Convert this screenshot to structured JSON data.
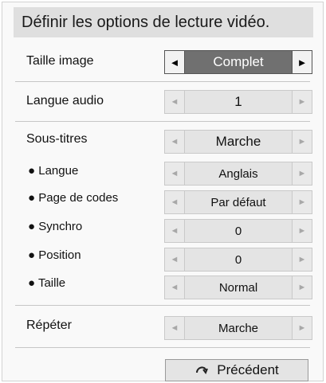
{
  "title": "Définir les options de lecture vidéo.",
  "rows": {
    "taille_image": {
      "label": "Taille image",
      "value": "Complet"
    },
    "langue_audio": {
      "label": "Langue audio",
      "value": "1"
    },
    "sous_titres": {
      "label": "Sous-titres",
      "value": "Marche"
    },
    "langue": {
      "label": "● Langue",
      "value": "Anglais"
    },
    "page_codes": {
      "label": "● Page de codes",
      "value": "Par défaut"
    },
    "synchro": {
      "label": "● Synchro",
      "value": "0"
    },
    "position": {
      "label": "● Position",
      "value": "0"
    },
    "taille": {
      "label": "● Taille",
      "value": "Normal"
    },
    "repeter": {
      "label": "Répéter",
      "value": "Marche"
    }
  },
  "arrows": {
    "left": "◄",
    "right": "►"
  },
  "back_button": {
    "label": "Précédent",
    "icon": "return-arrow-icon"
  }
}
